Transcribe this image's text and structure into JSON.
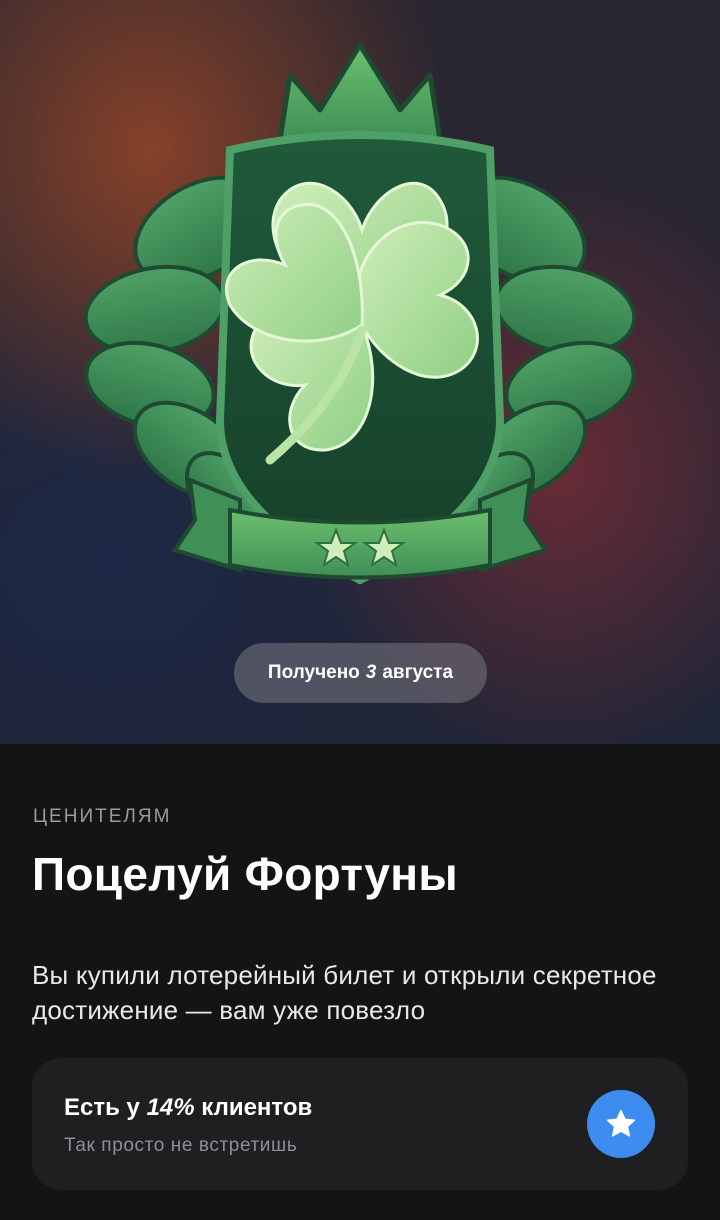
{
  "achievement": {
    "received_prefix": "Получено",
    "received_day": "3",
    "received_month": "августа",
    "category": "ЦЕНИТЕЛЯМ",
    "title": "Поцелуй Фортуны",
    "description": "Вы купили лотерейный билет и открыли секретное достижение — вам уже повезло"
  },
  "rarity": {
    "prefix": "Есть у",
    "percent": "14%",
    "suffix": "клиентов",
    "subtitle": "Так просто не встретишь",
    "icon": "star-icon"
  },
  "emblem": {
    "icon": "four-leaf-clover-crest-icon",
    "stars_count": 2
  },
  "colors": {
    "accent": "#3d8cf0",
    "background": "#141414",
    "card": "#1f1f22",
    "emblem_green": "#3f8f57"
  }
}
